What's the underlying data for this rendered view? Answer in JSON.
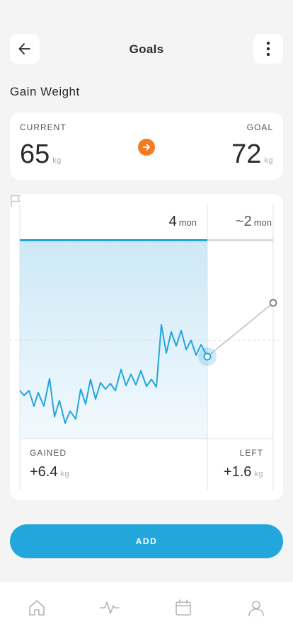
{
  "header": {
    "title": "Goals",
    "back_icon": "arrow-left-icon",
    "menu_icon": "more-vertical-icon"
  },
  "goal_name": "Gain Weight",
  "weights": {
    "current_label": "CURRENT",
    "current_value": "65",
    "current_unit": "kg",
    "goal_label": "GOAL",
    "goal_value": "72",
    "goal_unit": "kg",
    "accent": "#f47c20"
  },
  "progress": {
    "elapsed_value": "4",
    "elapsed_unit": "mon",
    "remaining_value": "~2",
    "remaining_unit": "mon",
    "elapsed_fraction": 0.74,
    "line_color": "#23a6dc"
  },
  "stats": {
    "gained_label": "GAINED",
    "gained_value": "+6.4",
    "gained_unit": "kg",
    "left_label": "LEFT",
    "left_value": "+1.6",
    "left_unit": "kg"
  },
  "add_button": "ADD",
  "tabs": [
    "home-icon",
    "activity-icon",
    "calendar-icon",
    "profile-icon"
  ]
}
